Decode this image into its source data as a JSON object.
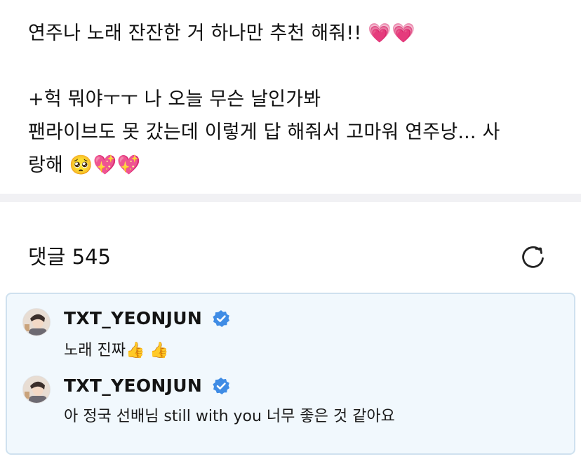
{
  "post": {
    "lines": [
      "연주나 노래 잔잔한 거 하나만 추천 해줘!! 💗💗",
      "",
      "+헉 뭐야ㅜㅜ 나 오늘 무슨 날인가봐",
      "팬라이브도 못 갔는데 이렇게 답 해줘서 고마워 연주낭... 사",
      "랑해 🥺💖💖"
    ]
  },
  "comments_section": {
    "count_label": "댓글 545",
    "refresh_icon": "refresh-icon"
  },
  "comments": [
    {
      "author": "TXT_YEONJUN",
      "verified": true,
      "text": "노래 진짜👍 👍"
    },
    {
      "author": "TXT_YEONJUN",
      "verified": true,
      "text": "아 정국 선배님 still with you 너무 좋은 것 같아요"
    }
  ],
  "colors": {
    "highlight_bg": "#f1f8fd",
    "highlight_border": "#cfe1ef",
    "verified_blue": "#3f8ce5",
    "divider": "#f1f1f4"
  }
}
